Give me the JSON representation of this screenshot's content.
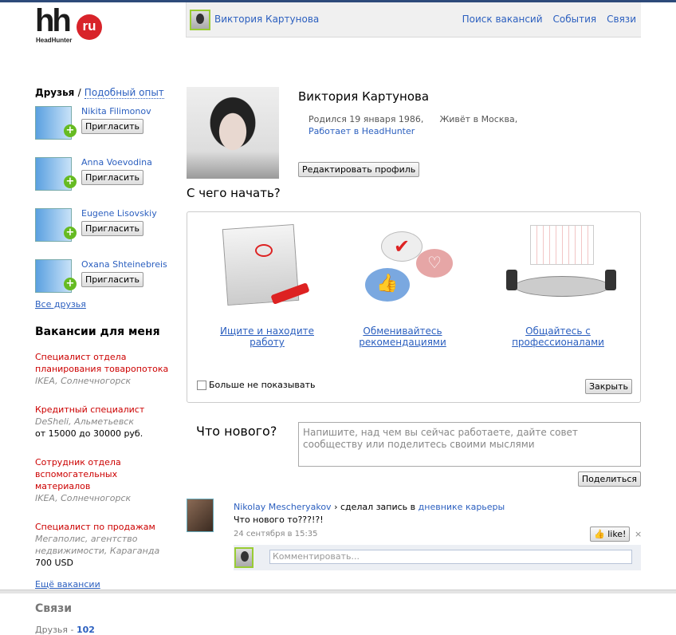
{
  "logo": {
    "mark": "hh",
    "badge": "ru",
    "sub": "HeadHunter"
  },
  "topbar": {
    "user": "Виктория Картунова",
    "nav": [
      "Поиск вакансий",
      "События",
      "Связи"
    ]
  },
  "sidebar": {
    "friends_title": "Друзья",
    "sep": "/",
    "similar": "Подобный опыт",
    "friends": [
      {
        "name": "Nikita Filimonov"
      },
      {
        "name": "Anna Voevodina"
      },
      {
        "name": "Eugene Lisovskiy"
      },
      {
        "name": "Oxana Shteinebreis"
      }
    ],
    "invite_label": "Пригласить",
    "all_friends": "Все друзья",
    "vacancies_title": "Вакансии для меня",
    "vacancies": [
      {
        "title": "Специалист отдела планирования товаропотока",
        "company": "IKEA, Солнечногорск",
        "salary": ""
      },
      {
        "title": "Кредитный специалист",
        "company": "DeSheli, Альметьевск",
        "salary": "от 15000 до 30000 руб."
      },
      {
        "title": "Сотрудник отдела вспомогательных материалов",
        "company": "IKEA, Солнечногорск",
        "salary": ""
      },
      {
        "title": "Специалист по продажам",
        "company": "Мегаполис, агентство недвижимости, Караганда",
        "salary": "700 USD"
      }
    ],
    "more_vacancies": "Ещё вакансии",
    "links_title": "Связи",
    "friends_count_label": "Друзья - ",
    "friends_count": "102"
  },
  "profile": {
    "name": "Виктория Картунова",
    "born": "Родился 19 января 1986,",
    "lives": "Живёт в Москва,",
    "works": "Работает в HeadHunter",
    "edit": "Редактировать профиль"
  },
  "start": {
    "title": "С чего начать?",
    "features": [
      "Ищите и находите работу",
      "Обменивайтесь рекомендациями",
      "Общайтесь с профессионалами"
    ],
    "dont_show": "Больше не показывать",
    "close": "Закрыть"
  },
  "whatsnew": {
    "title": "Что нового?",
    "placeholder": "Напишите, над чем вы сейчас работаете, дайте совет сообществу или поделитесь своими мыслями",
    "share": "Поделиться"
  },
  "post": {
    "author": "Nikolay Mescheryakov",
    "action": "› сделал запись в",
    "target": "дневнике карьеры",
    "text": "Что нового то???!?!",
    "date": "24 сентября в 15:35",
    "like": "like!",
    "close": "×",
    "comment_placeholder": "Комментировать..."
  }
}
